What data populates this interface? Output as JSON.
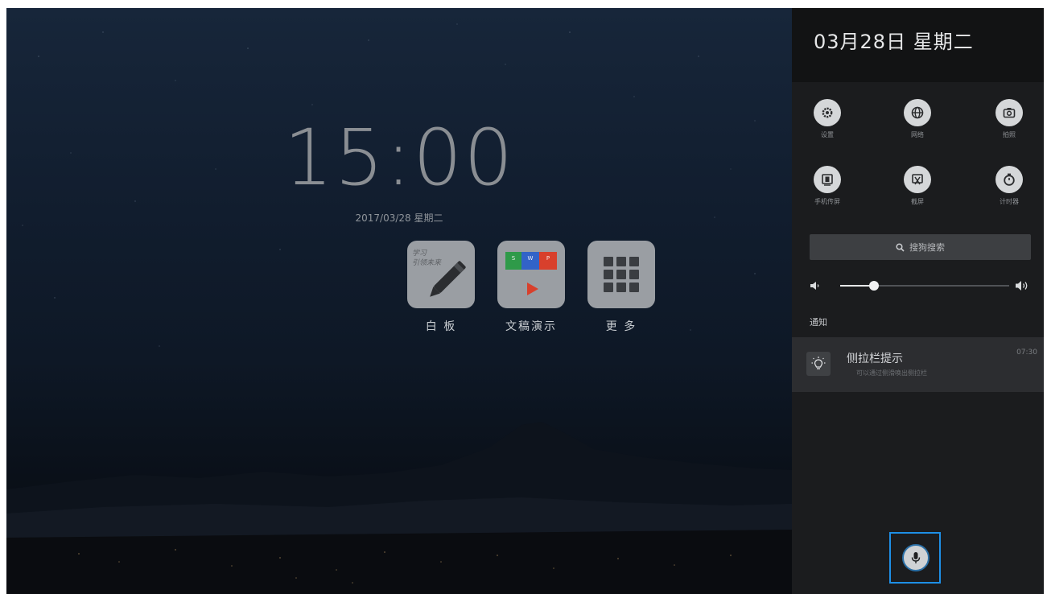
{
  "desktop": {
    "time": "15:00",
    "date": "2017/03/28 星期二",
    "apps": [
      {
        "label": "白 板",
        "tile_text": "学习\n引领未来"
      },
      {
        "label": "文稿演示"
      },
      {
        "label": "更 多"
      }
    ]
  },
  "panel": {
    "date": "03月28日 星期二",
    "quick_settings": [
      {
        "label": "设置",
        "icon": "gear-icon"
      },
      {
        "label": "网络",
        "icon": "globe-icon"
      },
      {
        "label": "拍照",
        "icon": "camera-icon"
      },
      {
        "label": "手机传屏",
        "icon": "screen-cast-icon"
      },
      {
        "label": "截屏",
        "icon": "screenshot-icon"
      },
      {
        "label": "计时器",
        "icon": "timer-icon"
      }
    ],
    "search": {
      "label": "搜狗搜索"
    },
    "volume": {
      "level": 0.2
    },
    "notifications_title": "通知",
    "notification": {
      "title": "侧拉栏提示",
      "subtitle": "可以通过侧滑唤出侧拉栏",
      "time": "07:30",
      "icon": "lightbulb-icon"
    },
    "voice": {
      "icon": "microphone-icon",
      "accent": "#1e8fe6"
    }
  }
}
